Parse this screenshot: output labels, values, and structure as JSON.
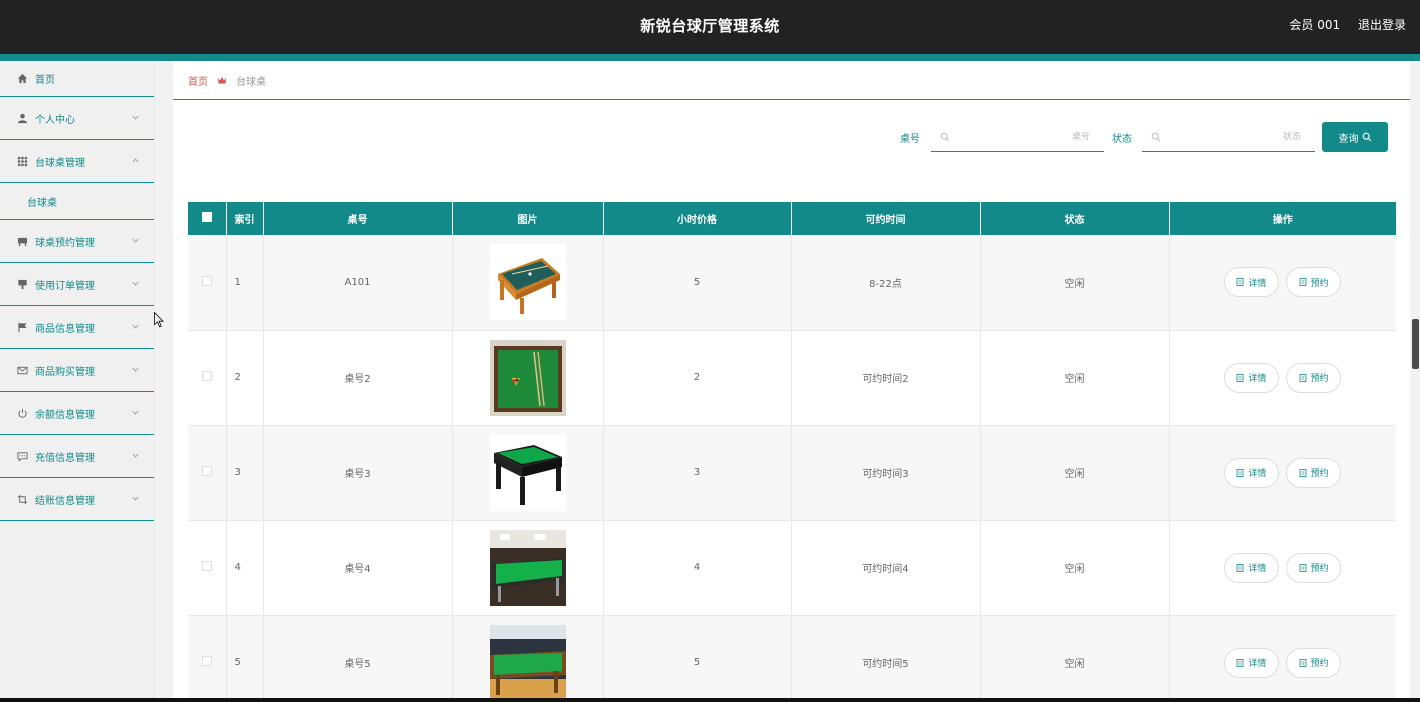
{
  "header": {
    "title": "新锐台球厅管理系统",
    "user": "会员 001",
    "logout": "退出登录"
  },
  "sidebar": {
    "items": [
      {
        "label": "首页",
        "icon": "home-icon"
      },
      {
        "label": "个人中心",
        "icon": "user-icon"
      },
      {
        "label": "台球桌管理",
        "icon": "grid-icon",
        "expanded": true,
        "children": [
          "台球桌"
        ]
      },
      {
        "label": "球桌预约管理",
        "icon": "table-icon"
      },
      {
        "label": "使用订单管理",
        "icon": "order-icon"
      },
      {
        "label": "商品信息管理",
        "icon": "flag-icon"
      },
      {
        "label": "商品购买管理",
        "icon": "mail-icon"
      },
      {
        "label": "余额信息管理",
        "icon": "power-icon"
      },
      {
        "label": "充值信息管理",
        "icon": "chat-icon"
      },
      {
        "label": "结账信息管理",
        "icon": "crop-icon"
      }
    ]
  },
  "breadcrumb": {
    "home": "首页",
    "current": "台球桌"
  },
  "search": {
    "table_no_label": "桌号",
    "table_no_placeholder": "桌号",
    "status_label": "状态",
    "status_placeholder": "状态",
    "query_button": "查询"
  },
  "table": {
    "headers": [
      "索引",
      "桌号",
      "图片",
      "小时价格",
      "可约时间",
      "状态",
      "操作"
    ],
    "rows": [
      {
        "index": "1",
        "table_no": "A101",
        "price": "5",
        "time": "8-22点",
        "status": "空闲"
      },
      {
        "index": "2",
        "table_no": "桌号2",
        "price": "2",
        "time": "可约时间2",
        "status": "空闲"
      },
      {
        "index": "3",
        "table_no": "桌号3",
        "price": "3",
        "time": "可约时间3",
        "status": "空闲"
      },
      {
        "index": "4",
        "table_no": "桌号4",
        "price": "4",
        "time": "可约时间4",
        "status": "空闲"
      },
      {
        "index": "5",
        "table_no": "桌号5",
        "price": "5",
        "time": "可约时间5",
        "status": "空闲"
      }
    ],
    "detail_button": "详情",
    "reserve_button": "预约"
  },
  "colors": {
    "accent": "#128a8a",
    "header_bg": "#222222",
    "breadcrumb_home": "#d9534f"
  }
}
